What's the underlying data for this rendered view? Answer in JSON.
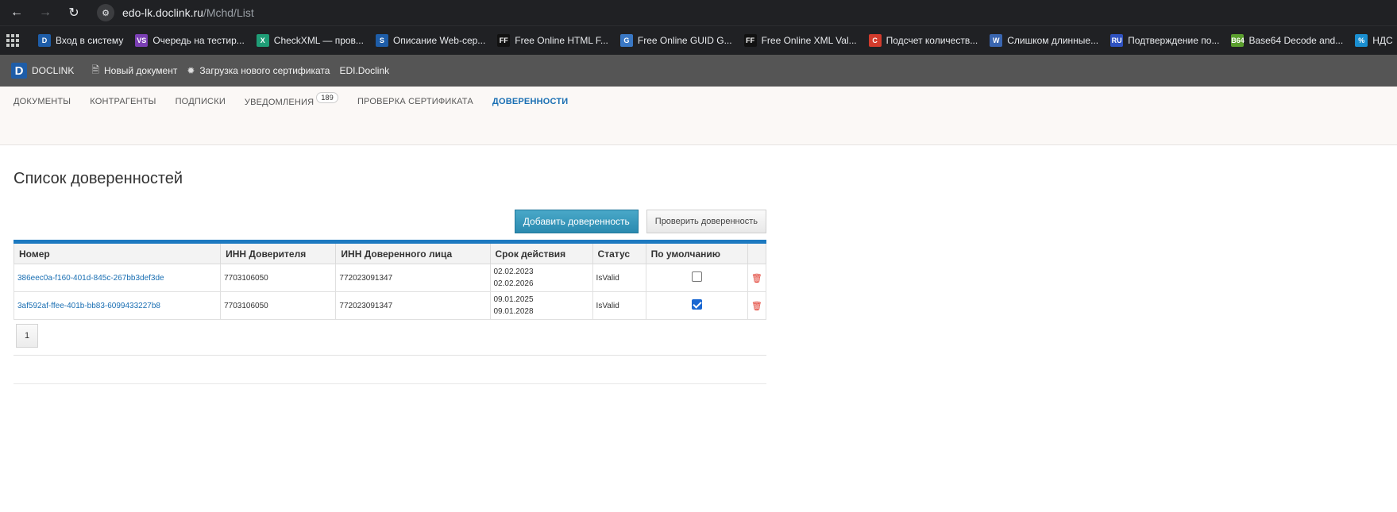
{
  "browser": {
    "url_host": "edo-lk.doclink.ru",
    "url_path": "/Mchd/List",
    "bookmarks": [
      {
        "label": "Вход в систему",
        "icon": "D",
        "color": "#1e5da8"
      },
      {
        "label": "Очередь на тестир...",
        "icon": "VS",
        "color": "#7b3fb4"
      },
      {
        "label": "CheckXML — пров...",
        "icon": "X",
        "color": "#1f9d76"
      },
      {
        "label": "Описание Web-сер...",
        "icon": "S",
        "color": "#1e5da8"
      },
      {
        "label": "Free Online HTML F...",
        "icon": "FF",
        "color": "#111111"
      },
      {
        "label": "Free Online GUID G...",
        "icon": "G",
        "color": "#3a78c4"
      },
      {
        "label": "Free Online XML Val...",
        "icon": "FF",
        "color": "#111111"
      },
      {
        "label": "Подсчет количеств...",
        "icon": "C",
        "color": "#d23b2c"
      },
      {
        "label": "Слишком длинные...",
        "icon": "W",
        "color": "#3a66b0"
      },
      {
        "label": "Подтверждение по...",
        "icon": "RU",
        "color": "#2f52c0"
      },
      {
        "label": "Base64 Decode and...",
        "icon": "B64",
        "color": "#5b9f2e"
      },
      {
        "label": "НДС",
        "icon": "%",
        "color": "#1a8fd1"
      }
    ]
  },
  "appbar": {
    "brand": "DOCLINK",
    "new_document": "Новый документ",
    "upload_certificate": "Загрузка нового сертификата",
    "edi": "EDI.Doclink"
  },
  "subnav": {
    "items": [
      {
        "label": "ДОКУМЕНТЫ"
      },
      {
        "label": "КОНТРАГЕНТЫ"
      },
      {
        "label": "ПОДПИСКИ"
      },
      {
        "label": "УВЕДОМЛЕНИЯ",
        "badge": "189"
      },
      {
        "label": "ПРОВЕРКА СЕРТИФИКАТА"
      },
      {
        "label": "ДОВЕРЕННОСТИ",
        "active": true
      }
    ]
  },
  "main": {
    "title": "Список доверенностей",
    "add_button": "Добавить доверенность",
    "check_button": "Проверить доверенность",
    "table": {
      "headers": [
        "Номер",
        "ИНН Доверителя",
        "ИНН Доверенного лица",
        "Срок действия",
        "Статус",
        "По умолчанию"
      ],
      "rows": [
        {
          "number": "386eec0a-f160-401d-845c-267bb3def3de",
          "inn_principal": "7703106050",
          "inn_trustee": "772023091347",
          "date_from": "02.02.2023",
          "date_to": "02.02.2026",
          "status": "IsValid",
          "is_default": false
        },
        {
          "number": "3af592af-ffee-401b-bb83-6099433227b8",
          "inn_principal": "7703106050",
          "inn_trustee": "772023091347",
          "date_from": "09.01.2025",
          "date_to": "09.01.2028",
          "status": "IsValid",
          "is_default": true
        }
      ]
    },
    "pagination": {
      "current_page": "1"
    }
  }
}
